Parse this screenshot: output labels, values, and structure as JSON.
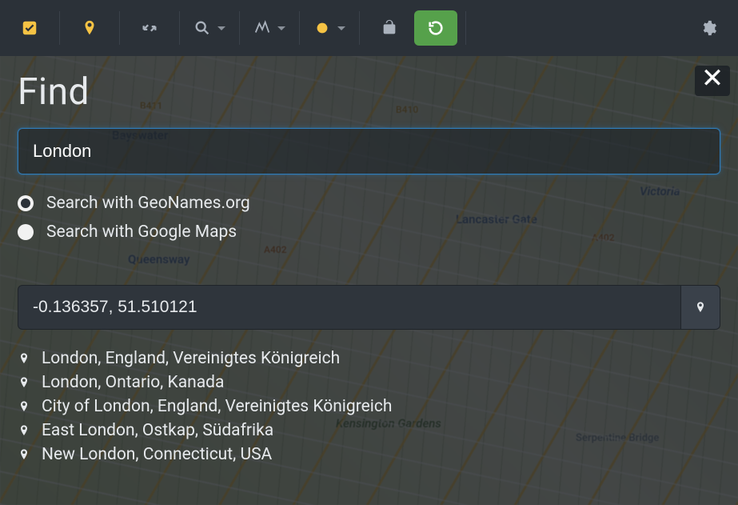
{
  "modal": {
    "title": "Find",
    "search_value": "London",
    "radio_geonames": "Search with GeoNames.org",
    "radio_google": "Search with Google Maps",
    "selected_radio": "geonames",
    "coords_value": "-0.136357, 51.510121"
  },
  "results": [
    "London, England, Vereinigtes Königreich",
    "London, Ontario, Kanada",
    "City of London, England, Vereinigtes Königreich",
    "East London, Ostkap, Südafrika",
    "New London, Connecticut, USA"
  ],
  "map_labels": {
    "bayswater": "Bayswater",
    "queensway": "Queensway",
    "lancaster": "Lancaster Gate",
    "victoria": "Victoria",
    "kensington": "Kensington Gardens",
    "serpentine": "Serpentine Bridge",
    "b411": "B411",
    "b410": "B410",
    "a402a": "A402",
    "a402b": "A402"
  },
  "toolbar": {
    "check": "check-icon",
    "pin": "pin-icon",
    "expand": "expand-icon",
    "search": "search-icon",
    "path": "path-icon",
    "dot": "circle-icon",
    "lock": "unlock-icon",
    "undo": "undo-icon",
    "gear": "gear-icon"
  }
}
